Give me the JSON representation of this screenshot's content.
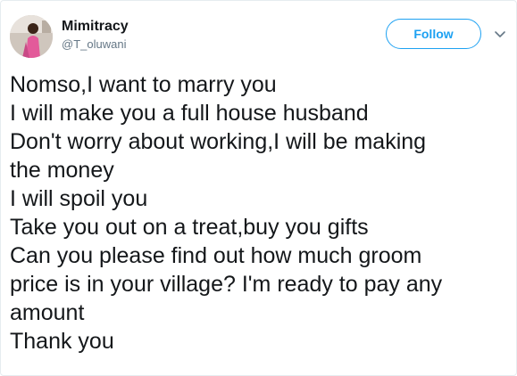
{
  "author": {
    "display_name": "Mimitracy",
    "handle": "@T_oluwani",
    "avatar_icon": "profile-photo"
  },
  "actions": {
    "follow_label": "Follow",
    "more_icon": "chevron-down-icon"
  },
  "tweet": {
    "lines": [
      "Nomso,I want to marry you",
      "I will make you a full house husband",
      "Don't worry about working,I will be making",
      "the money",
      "I will spoil you",
      "Take you out on a treat,buy you gifts",
      "Can you please find out how much groom",
      "price is in your village? I'm ready to pay any",
      "amount",
      "Thank you"
    ]
  },
  "colors": {
    "accent": "#1da1f2",
    "text": "#14171a",
    "secondary_text": "#657786",
    "border": "#e6ecf0"
  }
}
